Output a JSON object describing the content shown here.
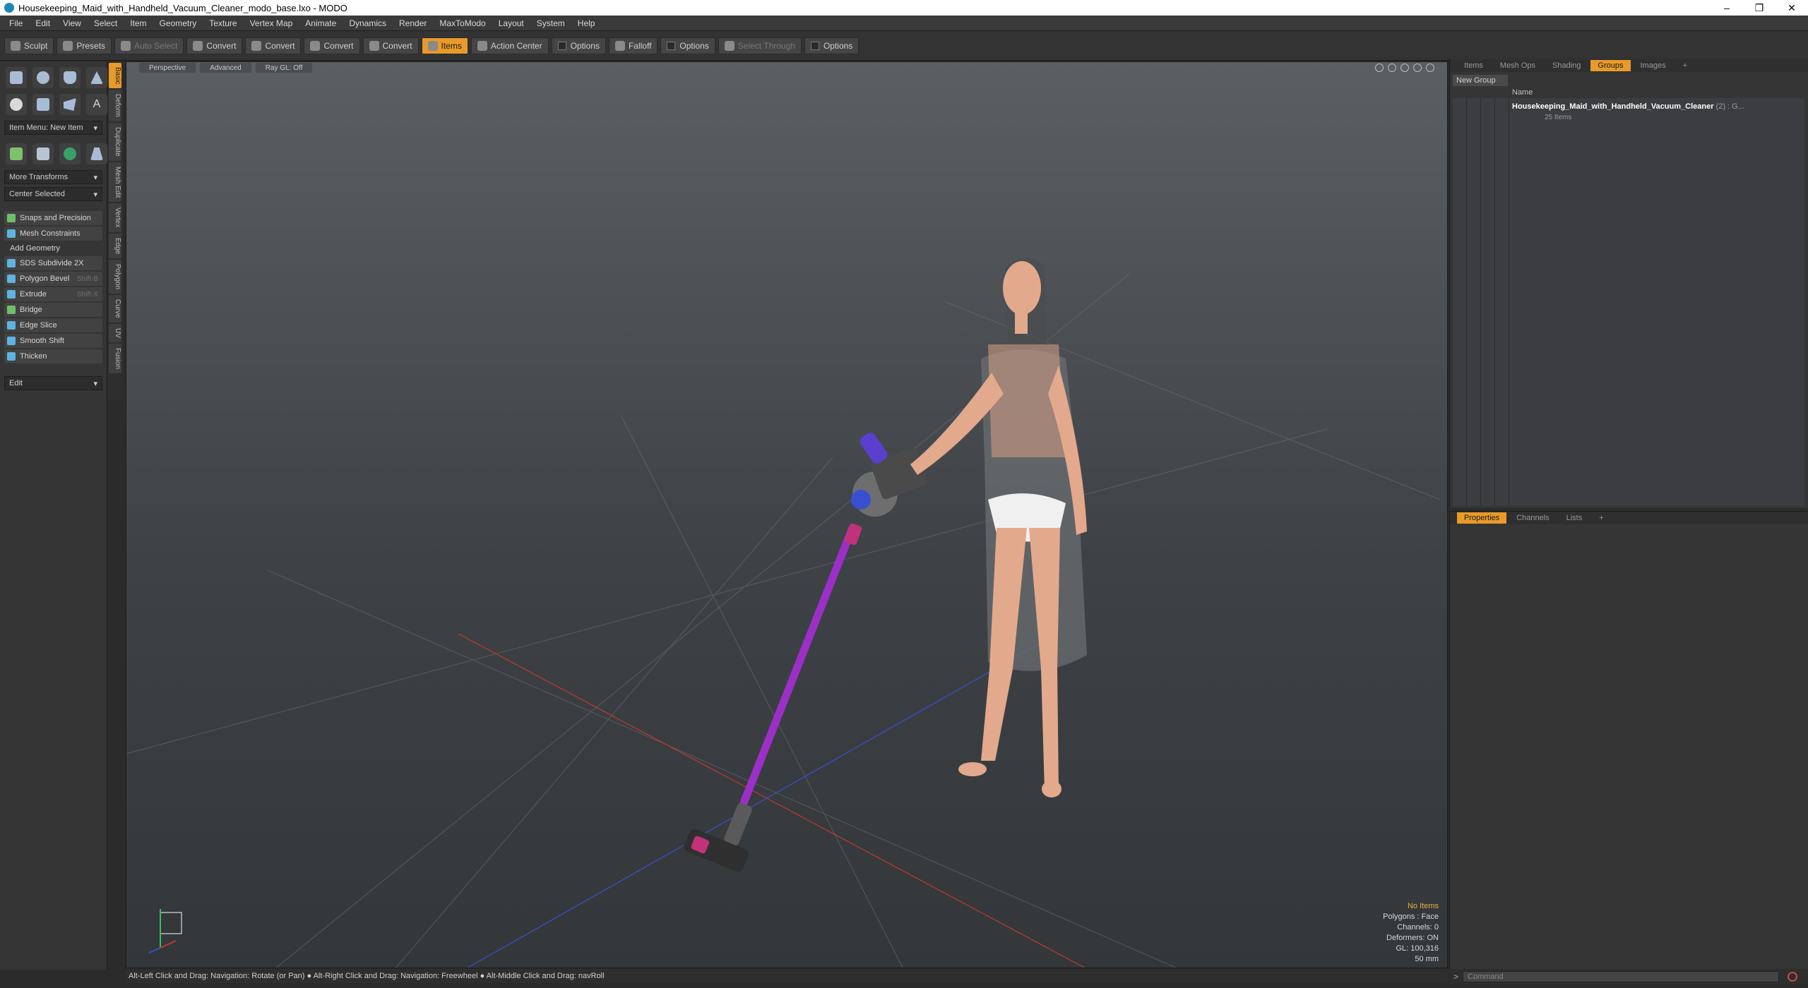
{
  "window": {
    "title": "Housekeeping_Maid_with_Handheld_Vacuum_Cleaner_modo_base.lxo - MODO",
    "controls": [
      "–",
      "❐",
      "✕"
    ]
  },
  "menu": [
    "File",
    "Edit",
    "View",
    "Select",
    "Item",
    "Geometry",
    "Texture",
    "Vertex Map",
    "Animate",
    "Dynamics",
    "Render",
    "MaxToModo",
    "Layout",
    "System",
    "Help"
  ],
  "toolbar": {
    "sculpt": "Sculpt",
    "presets": "Presets",
    "auto_select": "Auto Select",
    "convert1": "Convert",
    "convert2": "Convert",
    "convert3": "Convert",
    "convert4": "Convert",
    "items": "Items",
    "action_center": "Action Center",
    "options1": "Options",
    "falloff": "Falloff",
    "options2": "Options",
    "select_through": "Select Through",
    "options3": "Options"
  },
  "left": {
    "item_menu": "Item Menu: New Item",
    "more_transforms": "More Transforms",
    "center_selected": "Center Selected",
    "snaps": "Snaps and Precision",
    "mesh_constraints": "Mesh Constraints",
    "add_geometry": "Add Geometry",
    "tools": [
      {
        "label": "SDS Subdivide 2X",
        "shortcut": ""
      },
      {
        "label": "Polygon Bevel",
        "shortcut": "Shift-B"
      },
      {
        "label": "Extrude",
        "shortcut": "Shift-X"
      },
      {
        "label": "Bridge",
        "shortcut": ""
      },
      {
        "label": "Edge Slice",
        "shortcut": ""
      },
      {
        "label": "Smooth Shift",
        "shortcut": ""
      },
      {
        "label": "Thicken",
        "shortcut": ""
      }
    ],
    "edit": "Edit"
  },
  "side_tabs": [
    "Basic",
    "Deform",
    "Duplicate",
    "Mesh Edit",
    "Vertex",
    "Edge",
    "Polygon",
    "Curve",
    "UV",
    "Fusion"
  ],
  "viewport": {
    "tabs": [
      "Perspective",
      "Advanced",
      "Ray GL: Off"
    ],
    "stats": {
      "no_items": "No Items",
      "polygons": "Polygons : Face",
      "channels": "Channels: 0",
      "deformers": "Deformers: ON",
      "gl": "GL: 100,316",
      "mm": "50 mm"
    }
  },
  "status": "Alt-Left Click and Drag: Navigation: Rotate (or Pan) ● Alt-Right Click and Drag: Navigation: Freewheel ● Alt-Middle Click and Drag: navRoll",
  "right_top": {
    "tabs": [
      "Items",
      "Mesh Ops",
      "Shading",
      "Groups",
      "Images",
      "+"
    ],
    "active_tab": "Groups",
    "new_group": "New Group",
    "name_header": "Name",
    "group_name": "Housekeeping_Maid_with_Handheld_Vacuum_Cleaner",
    "group_suffix": " (2) : G...",
    "group_items": "25 Items"
  },
  "right_bottom": {
    "tabs": [
      "Properties",
      "Channels",
      "Lists",
      "+"
    ]
  },
  "command": {
    "prompt": ">",
    "placeholder": "Command"
  },
  "colors": {
    "accent": "#e89a2a",
    "vacuum_purple": "#9b2fc7",
    "skin": "#e3a98c"
  }
}
